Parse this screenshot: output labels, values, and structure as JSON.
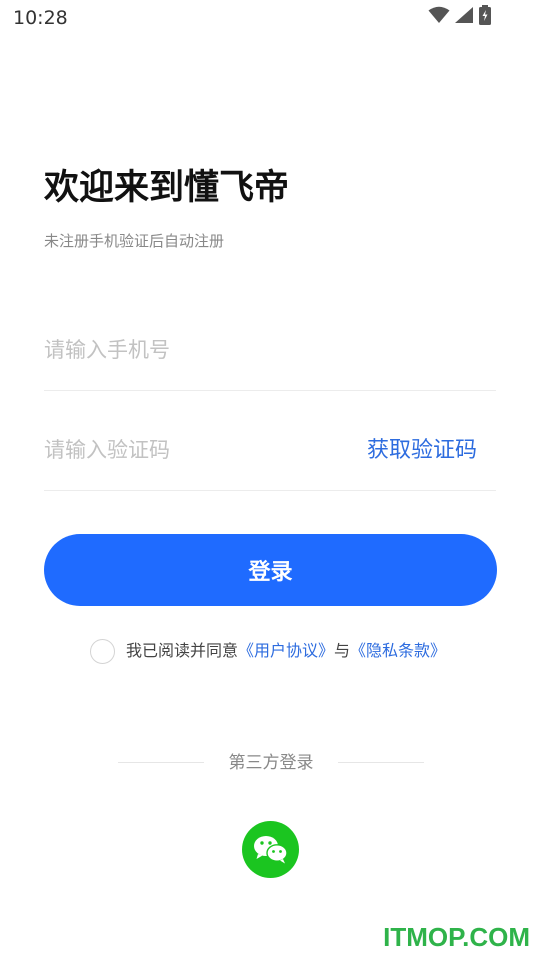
{
  "status_bar": {
    "time": "10:28",
    "icons": [
      "wifi-icon",
      "cellular-signal-icon",
      "battery-charging-icon"
    ]
  },
  "welcome": {
    "title": "欢迎来到懂飞帝",
    "subtitle": "未注册手机验证后自动注册"
  },
  "form": {
    "phone_placeholder": "请输入手机号",
    "phone_value": "",
    "code_placeholder": "请输入验证码",
    "code_value": "",
    "get_code_label": "获取验证码",
    "login_label": "登录"
  },
  "agreement": {
    "checked": false,
    "prefix": "我已阅读并同意",
    "user_agreement": "《用户协议》",
    "connector": "与",
    "privacy_policy": "《隐私条款》"
  },
  "third_party": {
    "label": "第三方登录",
    "providers": [
      "wechat-icon"
    ]
  },
  "watermark": "ITMOP.COM",
  "colors": {
    "primary": "#1f6bff",
    "link": "#2d6cdf",
    "wechat": "#1bc520",
    "watermark": "#2fb34a"
  }
}
